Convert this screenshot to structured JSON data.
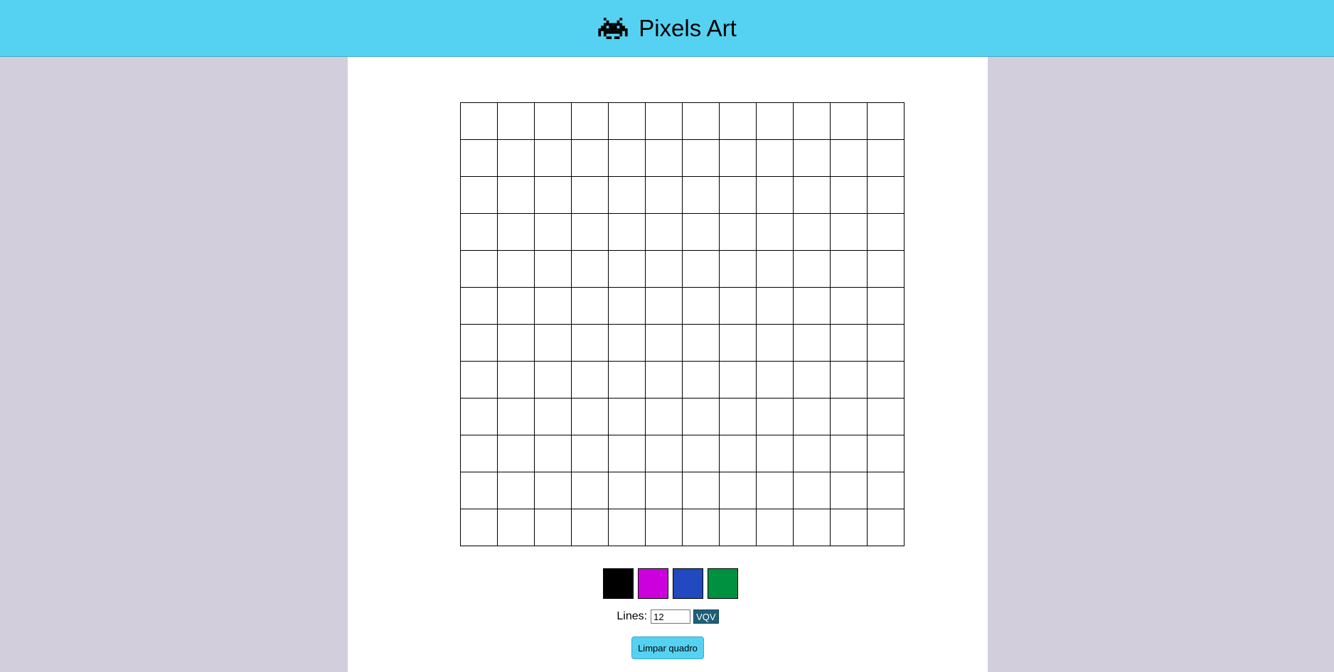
{
  "header": {
    "title": "Pixels Art",
    "icon": "space-invader-icon"
  },
  "board": {
    "size": 12
  },
  "palette": {
    "colors": [
      "#000000",
      "#cc00dd",
      "#2149c0",
      "#009140"
    ]
  },
  "controls": {
    "lines_label": "Lines:",
    "lines_value": "12",
    "vqv_label": "VQV",
    "clear_label": "Limpar quadro"
  }
}
